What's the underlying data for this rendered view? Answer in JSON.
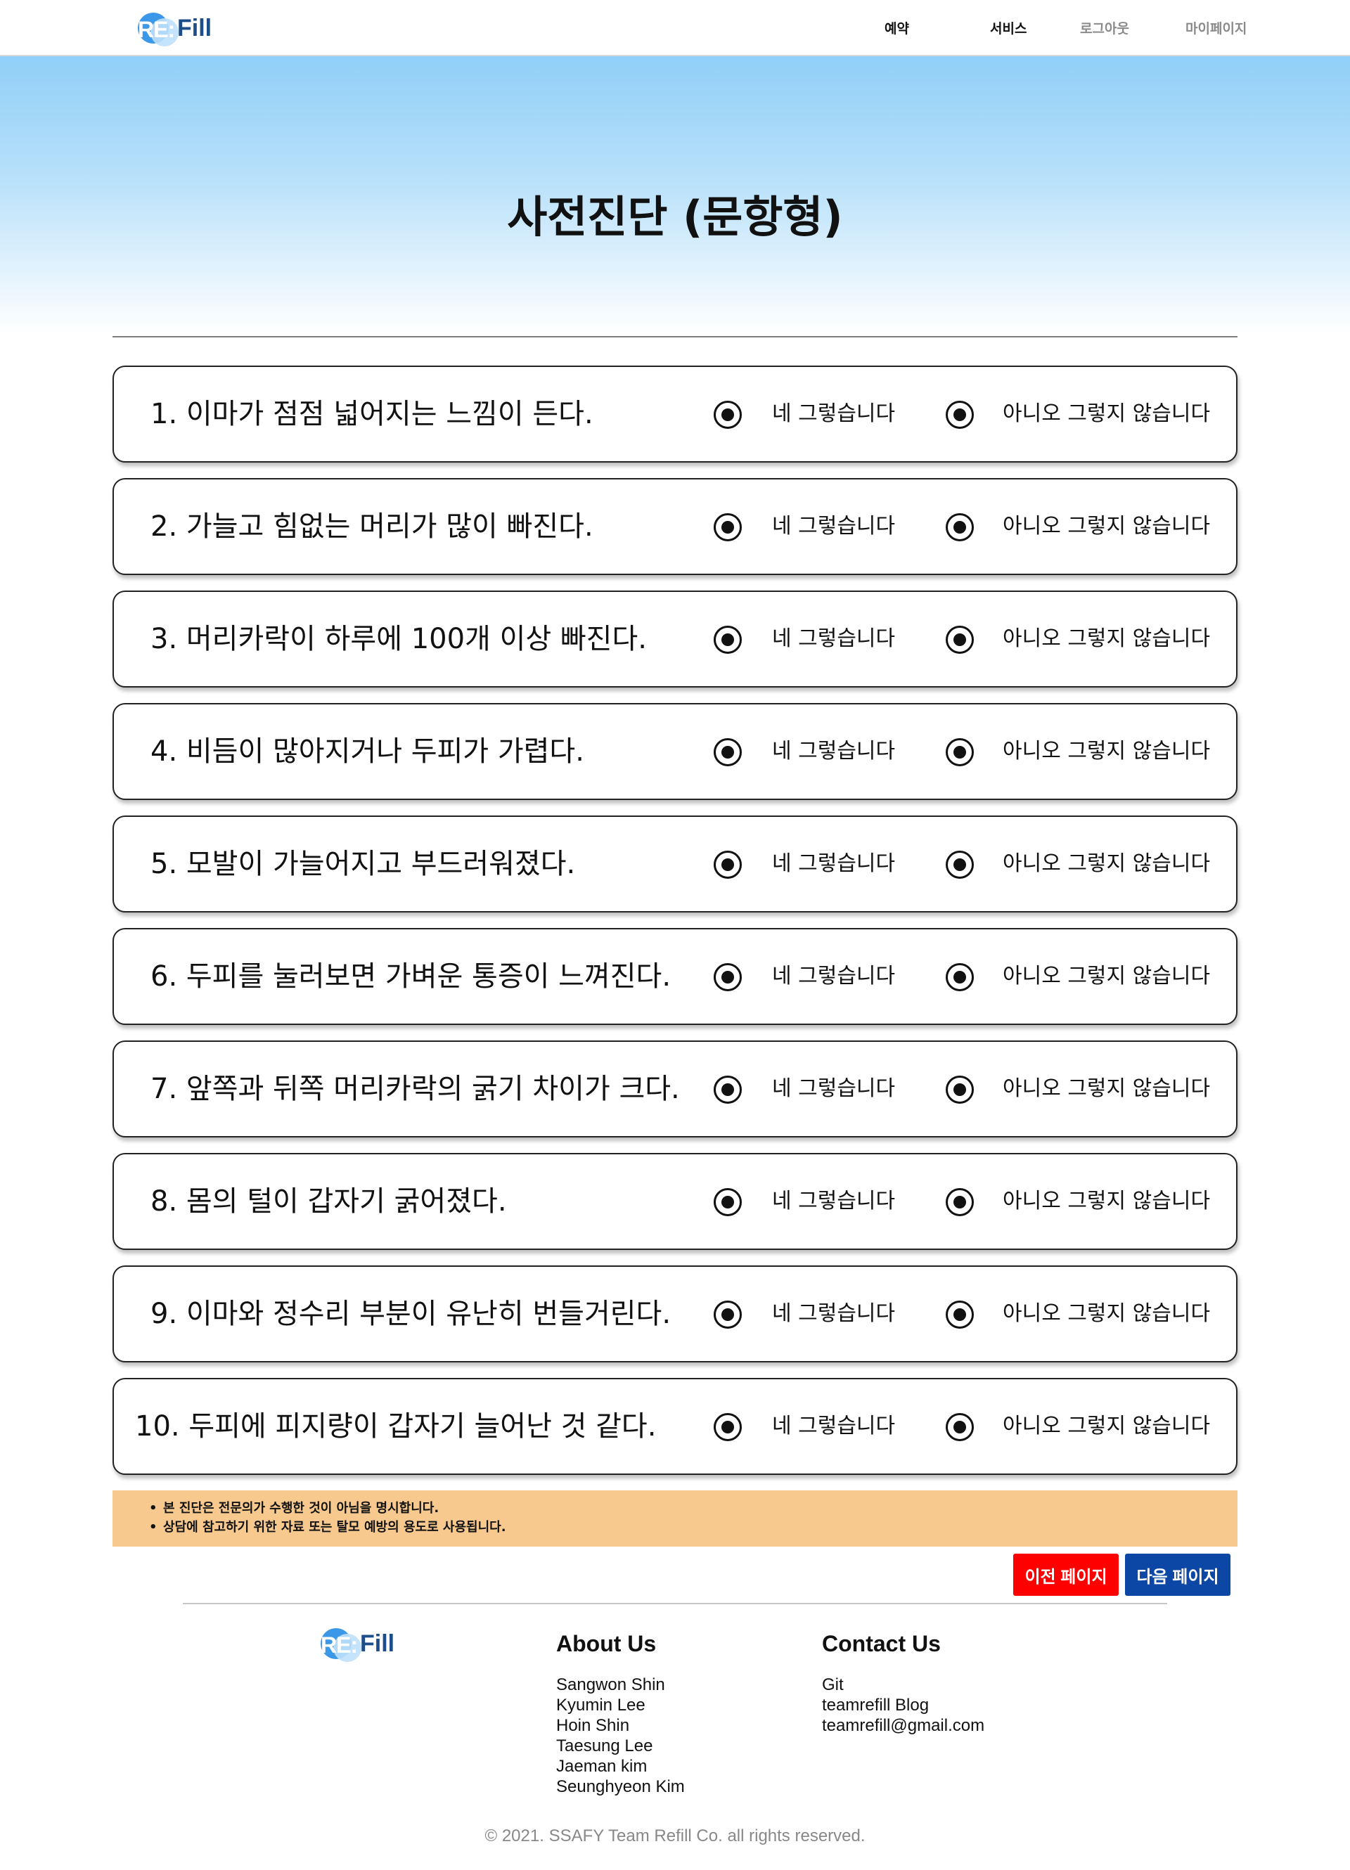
{
  "brand": {
    "logo_mark": "RE:",
    "logo_text": "Fill"
  },
  "nav": {
    "items": [
      {
        "label": "예약"
      },
      {
        "label": "서비스"
      },
      {
        "label": "로그아웃"
      },
      {
        "label": "마이페이지"
      }
    ]
  },
  "hero": {
    "title": "사전진단 (문항형)"
  },
  "options": {
    "yes": "네 그렇습니다",
    "no": "아니오 그렇지 않습니다"
  },
  "questions": [
    {
      "text": "1. 이마가 점점 넓어지는 느낌이 든다."
    },
    {
      "text": "2. 가늘고 힘없는 머리가 많이 빠진다."
    },
    {
      "text": "3. 머리카락이 하루에 100개 이상 빠진다."
    },
    {
      "text": "4. 비듬이 많아지거나 두피가 가렵다."
    },
    {
      "text": "5. 모발이 가늘어지고 부드러워졌다."
    },
    {
      "text": "6. 두피를 눌러보면 가벼운 통증이 느껴진다."
    },
    {
      "text": "7. 앞쪽과 뒤쪽 머리카락의 굵기 차이가 크다."
    },
    {
      "text": "8. 몸의 털이 갑자기 굵어졌다."
    },
    {
      "text": "9. 이마와 정수리 부분이 유난히 번들거린다."
    },
    {
      "text": "10. 두피에 피지량이 갑자기 늘어난 것 같다."
    }
  ],
  "notice": {
    "lines": [
      "본 진단은 전문의가 수행한 것이 아님을 명시합니다.",
      "상담에 참고하기 위한 자료 또는 탈모 예방의 용도로 사용됩니다."
    ]
  },
  "buttons": {
    "prev": "이전 페이지",
    "next": "다음 페이지"
  },
  "footer": {
    "about": {
      "heading": "About Us",
      "members": [
        "Sangwon Shin",
        "Kyumin Lee",
        "Hoin Shin",
        "Taesung Lee",
        "Jaeman kim",
        "Seunghyeon Kim"
      ]
    },
    "contact": {
      "heading": "Contact Us",
      "links": [
        "Git",
        "teamrefill Blog",
        "teamrefill@gmail.com"
      ]
    },
    "copyright": "© 2021. SSAFY Team Refill Co. all rights reserved."
  },
  "colors": {
    "prev_button": "#ff0000",
    "next_button": "#0d47a6",
    "notice_bg": "#f7c98f",
    "hero_gradient_top": "#90cff7",
    "logo_blue": "#3b97e8"
  },
  "icons": {
    "logo": "refill-logo",
    "radio": "radio-selected-icon"
  }
}
